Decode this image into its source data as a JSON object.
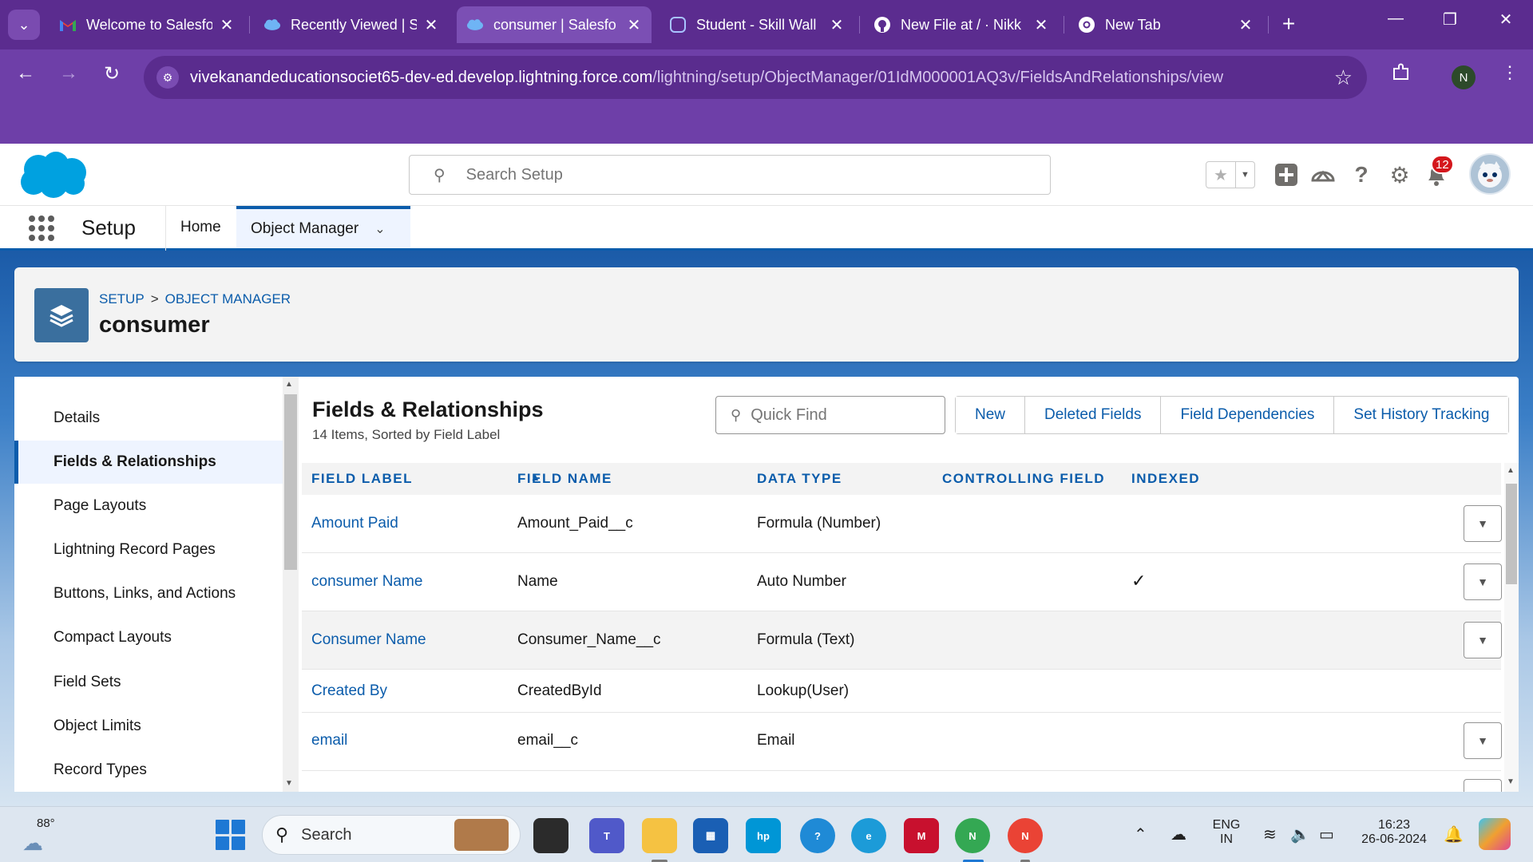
{
  "browser": {
    "tabs": [
      {
        "title": "Welcome to Salesfo",
        "favicon": "gmail-icon"
      },
      {
        "title": "Recently Viewed | S",
        "favicon": "salesforce-cloud-icon"
      },
      {
        "title": "consumer | Salesfo",
        "favicon": "salesforce-cloud-icon",
        "active": true
      },
      {
        "title": "Student - Skill Wall",
        "favicon": "skillwallet-icon"
      },
      {
        "title": "New File at / · Nikk",
        "favicon": "github-icon"
      },
      {
        "title": "New Tab",
        "favicon": "chrome-icon"
      }
    ],
    "url_host": "vivekanandeducationsociet65-dev-ed.develop.lightning.force.com",
    "url_path": "/lightning/setup/ObjectManager/01IdM000001AQ3v/FieldsAndRelationships/view",
    "profile_initial": "N"
  },
  "header": {
    "search_placeholder": "Search Setup",
    "notification_count": "12"
  },
  "nav": {
    "app_name": "Setup",
    "items": [
      {
        "label": "Home"
      },
      {
        "label": "Object Manager"
      }
    ]
  },
  "object": {
    "breadcrumb": {
      "setup": "SETUP",
      "sep": ">",
      "object_manager": "OBJECT MANAGER"
    },
    "title": "consumer"
  },
  "sidebar": {
    "items": [
      {
        "label": "Details"
      },
      {
        "label": "Fields & Relationships",
        "active": true
      },
      {
        "label": "Page Layouts"
      },
      {
        "label": "Lightning Record Pages"
      },
      {
        "label": "Buttons, Links, and Actions"
      },
      {
        "label": "Compact Layouts"
      },
      {
        "label": "Field Sets"
      },
      {
        "label": "Object Limits"
      },
      {
        "label": "Record Types"
      }
    ]
  },
  "fields": {
    "title": "Fields & Relationships",
    "subtitle": "14 Items, Sorted by Field Label",
    "quick_find_placeholder": "Quick Find",
    "buttons": [
      "New",
      "Deleted Fields",
      "Field Dependencies",
      "Set History Tracking"
    ],
    "columns": [
      "FIELD LABEL",
      "FIELD NAME",
      "DATA TYPE",
      "CONTROLLING FIELD",
      "INDEXED"
    ],
    "rows": [
      {
        "label": "Amount Paid",
        "name": "Amount_Paid__c",
        "type": "Formula (Number)",
        "controlling": "",
        "indexed": false,
        "has_action": true
      },
      {
        "label": "consumer Name",
        "name": "Name",
        "type": "Auto Number",
        "controlling": "",
        "indexed": true,
        "has_action": true
      },
      {
        "label": "Consumer Name",
        "name": "Consumer_Name__c",
        "type": "Formula (Text)",
        "controlling": "",
        "indexed": false,
        "has_action": true
      },
      {
        "label": "Created By",
        "name": "CreatedById",
        "type": "Lookup(User)",
        "controlling": "",
        "indexed": false,
        "has_action": false
      },
      {
        "label": "email",
        "name": "email__c",
        "type": "Email",
        "controlling": "",
        "indexed": false,
        "has_action": true
      }
    ]
  },
  "taskbar": {
    "temperature": "88°",
    "search_label": "Search",
    "language": "ENG",
    "region": "IN",
    "time": "16:23",
    "date": "26-06-2024"
  },
  "colors": {
    "browser_tabstrip": "#5b2c8f",
    "browser_toolbar": "#6e3fa8",
    "salesforce_blue": "#0b5cab",
    "salesforce_logo": "#00a1e0"
  }
}
